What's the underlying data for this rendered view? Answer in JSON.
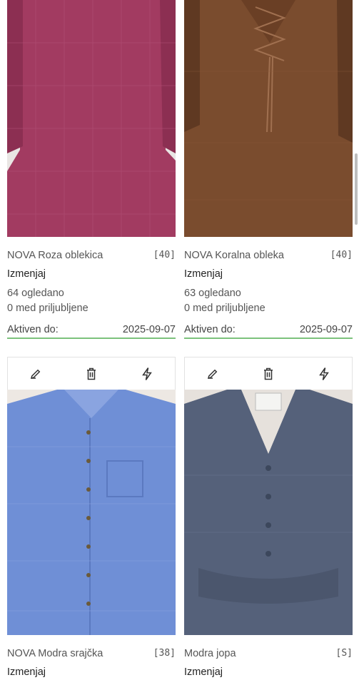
{
  "products": [
    {
      "title": "NOVA Roza oblekica",
      "size": "[40]",
      "action": "Izmenjaj",
      "views": "64 ogledano",
      "favorites": "0 med priljubljene",
      "active_label": "Aktiven do:",
      "active_date": "2025-09-07",
      "color": "#a23b61",
      "show_toolbar": false
    },
    {
      "title": "NOVA Koralna obleka",
      "size": "[40]",
      "action": "Izmenjaj",
      "views": "63 ogledano",
      "favorites": "0 med priljubljene",
      "active_label": "Aktiven do:",
      "active_date": "2025-09-07",
      "color": "#7a4c2e",
      "show_toolbar": false
    },
    {
      "title": "NOVA Modra srajčka",
      "size": "[38]",
      "action": "Izmenjaj",
      "color": "#6f8fd6",
      "show_toolbar": true
    },
    {
      "title": "Modra jopa",
      "size": "[S]",
      "action": "Izmenjaj",
      "color": "#55617a",
      "show_toolbar": true
    }
  ],
  "toolbar_icons": [
    "edit-icon",
    "trash-icon",
    "boost-icon"
  ]
}
